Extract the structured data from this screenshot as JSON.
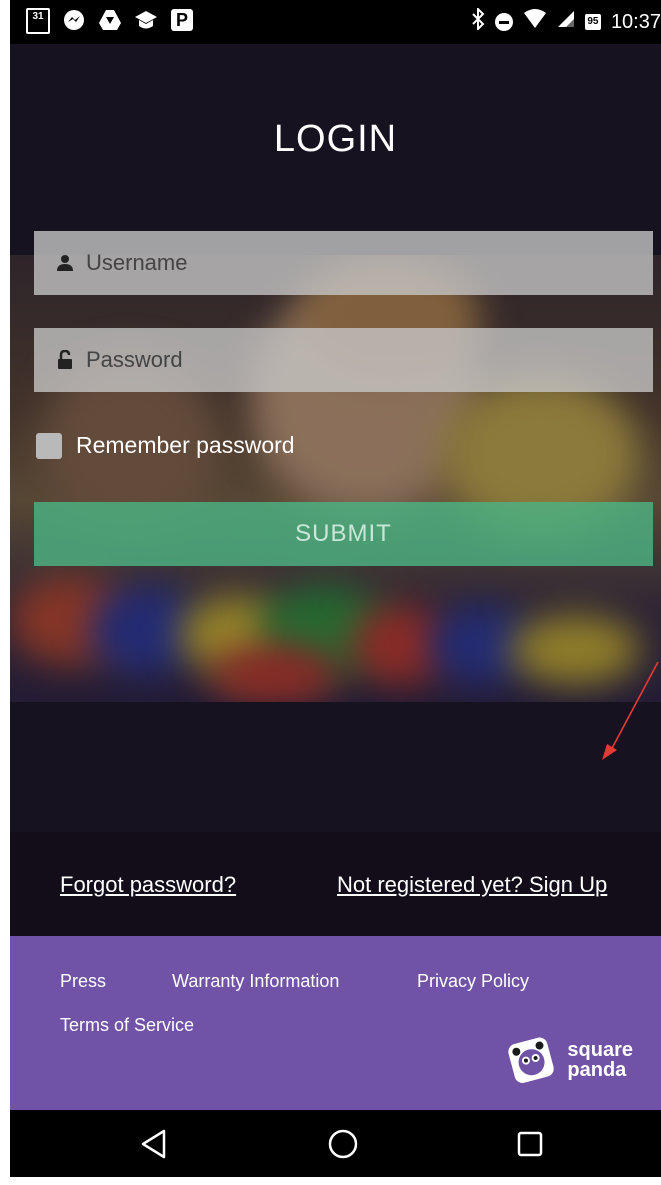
{
  "status_bar": {
    "left_icons": [
      "calendar-icon",
      "messenger-icon",
      "drive-icon",
      "education-icon",
      "parking-icon"
    ],
    "calendar_day": "31",
    "parking_label": "P",
    "battery_level": "95",
    "time": "10:37"
  },
  "login": {
    "title": "LOGIN",
    "username_placeholder": "Username",
    "password_placeholder": "Password",
    "remember_label": "Remember password",
    "remember_checked": false,
    "submit_label": "SUBMIT"
  },
  "links": {
    "forgot": "Forgot password?",
    "signup": "Not registered yet? Sign Up"
  },
  "footer": {
    "items": [
      "Press",
      "Warranty Information",
      "Privacy Policy",
      "Terms of Service"
    ],
    "logo_line1": "square",
    "logo_line2": "panda"
  },
  "navbar": {
    "buttons": [
      "back-icon",
      "home-icon",
      "recents-icon"
    ]
  },
  "colors": {
    "background": "#17121f",
    "submit": "#4cb282",
    "footer": "#7053a6",
    "annotation_arrow": "#e53935"
  }
}
